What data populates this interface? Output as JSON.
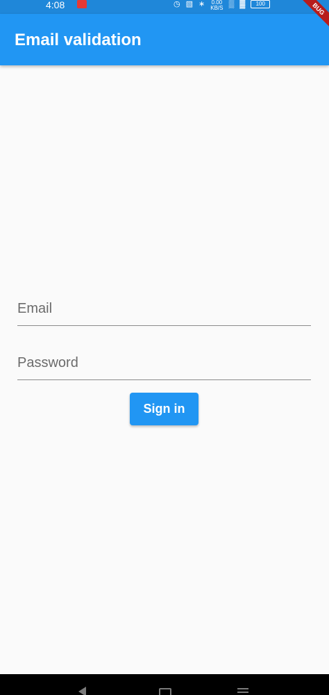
{
  "status_bar": {
    "time": "4:08",
    "net_speed_value": "0.00",
    "net_speed_unit": "KB/S",
    "battery": "100"
  },
  "app_bar": {
    "title": "Email validation",
    "debug_banner": "BUG"
  },
  "form": {
    "email_placeholder": "Email",
    "email_value": "",
    "password_placeholder": "Password",
    "password_value": "",
    "sign_in_label": "Sign in"
  },
  "colors": {
    "primary": "#2196f3",
    "background": "#fafafa",
    "nav_bar": "#000000"
  },
  "icons": {
    "status": [
      "notification-icon",
      "alarm-icon",
      "vibrate-icon",
      "bluetooth-icon",
      "signal-icon",
      "wifi-icon",
      "battery-icon"
    ],
    "nav": [
      "back-icon",
      "home-icon",
      "menu-icon"
    ]
  }
}
